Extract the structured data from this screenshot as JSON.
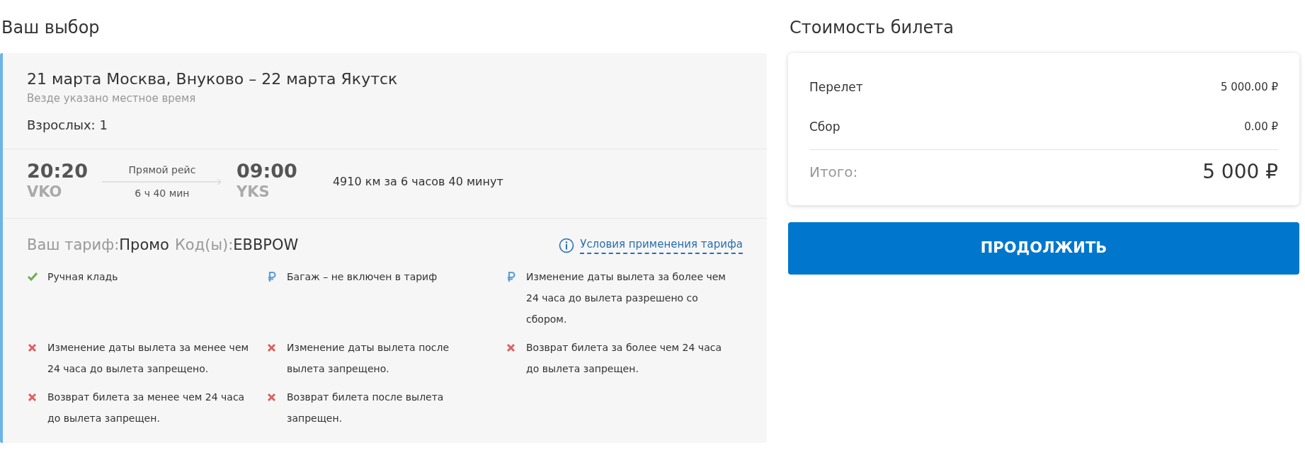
{
  "choice": {
    "heading": "Ваш выбор",
    "route": "21 марта Москва, Внуково – 22 марта Якутск",
    "time_note": "Везде указано местное время",
    "passengers": "Взрослых: 1",
    "flight": {
      "departure_time": "20:20",
      "departure_airport": "VKO",
      "flight_type": "Прямой рейс",
      "duration": "6 ч 40 мин",
      "arrival_time": "09:00",
      "arrival_airport": "YKS",
      "distance": "4910 км за 6 часов 40 минут"
    },
    "tariff": {
      "label": "Ваш тариф:",
      "name": "Промо",
      "code_label": "Код(ы):",
      "code": "EBBPOW",
      "conditions_link": "Условия применения тарифа"
    },
    "rules": [
      {
        "kind": "included",
        "text": "Ручная кладь"
      },
      {
        "kind": "paid",
        "text": "Багаж – не включен в тариф"
      },
      {
        "kind": "paid",
        "text": "Изменение даты вылета за более чем 24 часа до вылета разрешено со сбором."
      },
      {
        "kind": "forbidden",
        "text": "Изменение даты вылета за менее чем 24 часа до вылета запрещено."
      },
      {
        "kind": "forbidden",
        "text": "Изменение даты вылета после вылета запрещено."
      },
      {
        "kind": "forbidden",
        "text": "Возврат билета за более чем 24 часа до вылета запрещен."
      },
      {
        "kind": "forbidden",
        "text": "Возврат билета за менее чем 24 часа до вылета запрещен."
      },
      {
        "kind": "forbidden",
        "text": "Возврат билета после вылета запрещен."
      }
    ]
  },
  "price": {
    "heading": "Стоимость билета",
    "lines": [
      {
        "label": "Перелет",
        "amount": "5 000.00 ₽"
      },
      {
        "label": "Сбор",
        "amount": "0.00 ₽"
      }
    ],
    "total_label": "Итого:",
    "total": "5 000 ₽",
    "continue_button": "ПРОДОЛЖИТЬ"
  }
}
